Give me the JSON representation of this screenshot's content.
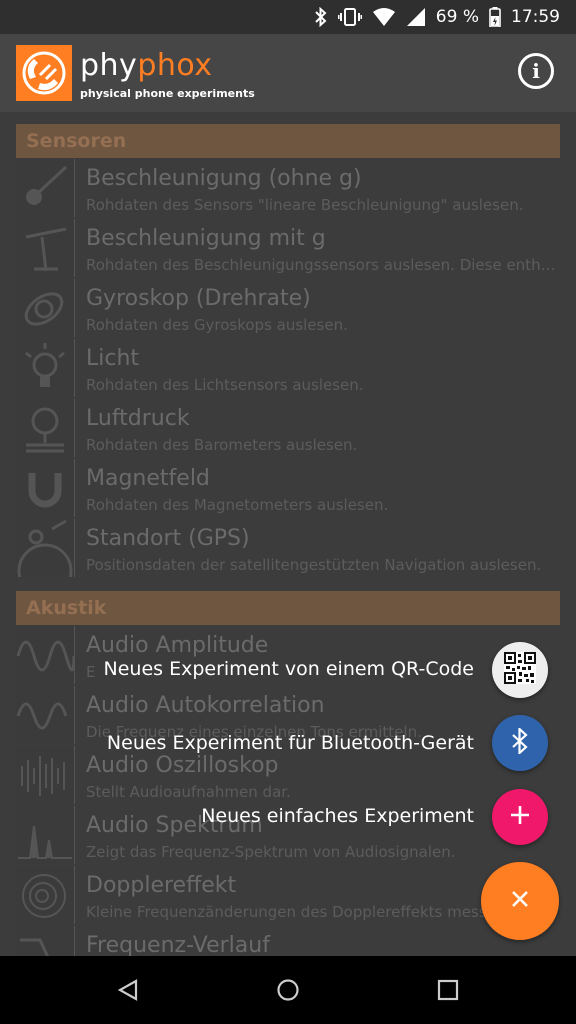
{
  "status": {
    "battery": "69 %",
    "time": "17:59"
  },
  "app": {
    "name_a": "phy",
    "name_b": "phox",
    "subtitle": "physical phone experiments"
  },
  "categories": [
    {
      "name": "Sensoren",
      "items": [
        {
          "title": "Beschleunigung (ohne g)",
          "desc": "Rohdaten des Sensors \"lineare Beschleunigung\" auslesen."
        },
        {
          "title": "Beschleunigung mit g",
          "desc": "Rohdaten des Beschleunigungssensors auslesen. Diese enthalten."
        },
        {
          "title": "Gyroskop (Drehrate)",
          "desc": "Rohdaten des Gyroskops auslesen."
        },
        {
          "title": "Licht",
          "desc": "Rohdaten des Lichtsensors auslesen."
        },
        {
          "title": "Luftdruck",
          "desc": "Rohdaten des Barometers auslesen."
        },
        {
          "title": "Magnetfeld",
          "desc": "Rohdaten des Magnetometers auslesen."
        },
        {
          "title": "Standort (GPS)",
          "desc": "Positionsdaten der satellitengestützten Navigation auslesen."
        }
      ]
    },
    {
      "name": "Akustik",
      "items": [
        {
          "title": "Audio Amplitude",
          "desc": "E"
        },
        {
          "title": "Audio Autokorrelation",
          "desc": "Die Frequenz eines einzelnen Tons ermitteln."
        },
        {
          "title": "Audio Oszilloskop",
          "desc": "Stellt Audioaufnahmen dar."
        },
        {
          "title": "Audio Spektrum",
          "desc": "Zeigt das Frequenz-Spektrum von Audiosignalen."
        },
        {
          "title": "Dopplereffekt",
          "desc": "Kleine Frequenzänderungen des Dopplereffekts messen."
        },
        {
          "title": "Frequenz-Verlauf",
          "desc": ""
        }
      ]
    }
  ],
  "fab_menu": {
    "qr_label": "Neues Experiment von einem QR-Code",
    "bluetooth_label": "Neues Experiment für Bluetooth-Gerät",
    "simple_label": "Neues einfaches Experiment",
    "colors": {
      "qr": "#eeeeee",
      "bluetooth": "#2f64ad",
      "simple": "#f0186a",
      "main": "#ff7e22"
    }
  }
}
